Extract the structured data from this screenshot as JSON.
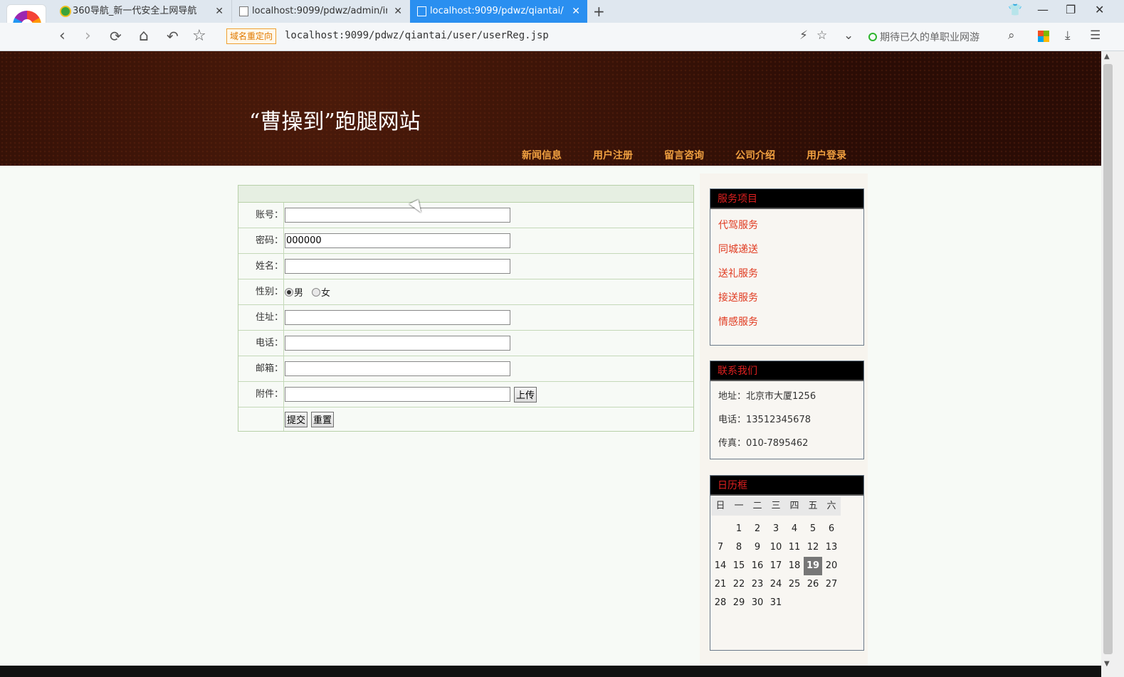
{
  "browser": {
    "tabs": [
      {
        "title": "360导航_新一代安全上网导航",
        "active": false
      },
      {
        "title": "localhost:9099/pdwz/admin/ir",
        "active": false
      },
      {
        "title": "localhost:9099/pdwz/qiantai/",
        "active": true
      }
    ],
    "new_tab": "+",
    "redirect_badge": "域名重定向",
    "url": "localhost:9099/pdwz/qiantai/user/userReg.jsp",
    "search_placeholder": "期待已久的单职业网游",
    "controls": {
      "back": "‹",
      "forward": "›",
      "reload": "⟳",
      "home": "⌂",
      "undo": "↶",
      "star": "☆"
    },
    "window": {
      "skin": "👕",
      "minimize": "—",
      "restore": "❐",
      "close": "✕"
    },
    "tab_close": "✕",
    "tools": {
      "flash": "⚡",
      "fav": "☆",
      "dropdown": "⌄",
      "search": "⌕",
      "download": "⤓",
      "menu": "☰"
    },
    "accent": "#2a8ff0"
  },
  "site": {
    "title": "“曹操到”跑腿网站",
    "nav": [
      "新闻信息",
      "用户注册",
      "留言咨询",
      "公司介绍",
      "用户登录"
    ]
  },
  "form": {
    "fields": {
      "account": {
        "label": "账号：",
        "value": ""
      },
      "password": {
        "label": "密码：",
        "value": "000000"
      },
      "name": {
        "label": "姓名：",
        "value": ""
      },
      "gender": {
        "label": "性别：",
        "options": [
          "男",
          "女"
        ],
        "selected": "男"
      },
      "address": {
        "label": "住址：",
        "value": ""
      },
      "phone": {
        "label": "电话：",
        "value": ""
      },
      "email": {
        "label": "邮箱：",
        "value": ""
      },
      "attachment": {
        "label": "附件：",
        "value": ""
      }
    },
    "upload_label": "上传",
    "submit_label": "提交",
    "reset_label": "重置"
  },
  "sidebar": {
    "services": {
      "title": "服务项目",
      "items": [
        "代驾服务",
        "同城递送",
        "送礼服务",
        "接送服务",
        "情感服务"
      ]
    },
    "contact": {
      "title": "联系我们",
      "lines": [
        "地址：北京市大厦1256",
        "电话：13512345678",
        "传真：010-7895462"
      ]
    },
    "calendar": {
      "title": "日历框",
      "weekdays": [
        "日",
        "一",
        "二",
        "三",
        "四",
        "五",
        "六"
      ],
      "first_weekday": 1,
      "days_in_month": 31,
      "today": 19
    }
  }
}
